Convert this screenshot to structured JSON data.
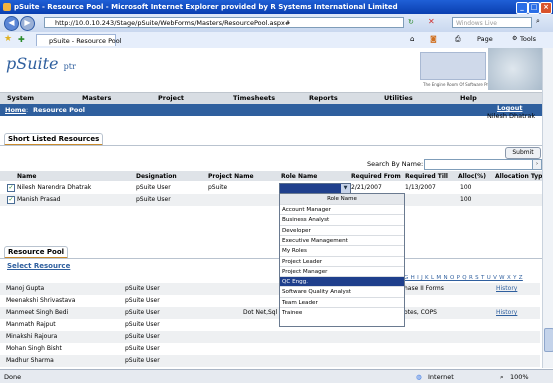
{
  "window": {
    "title": "pSuite - Resource Pool - Microsoft Internet Explorer provided by R Systems International Limited"
  },
  "address": {
    "url": "http://10.0.10.243/Stage/pSuite/WebForms/Masters/ResourcePool.aspx#",
    "search_placeholder": "Windows Live"
  },
  "tabbar": {
    "tab_label": "pSuite - Resource Pool",
    "page_label": "Page",
    "tools_label": "Tools"
  },
  "header": {
    "logo": "pSuite",
    "logo_suffix": "ptr",
    "rs_caption": "The Engine Room Of Software Products"
  },
  "menu": [
    "System",
    "Masters",
    "Project",
    "Timesheets",
    "Reports",
    "Utilities",
    "Help"
  ],
  "breadcrumb": {
    "home": "Home",
    "sep": " : ",
    "current": "Resource Pool",
    "logout": "Logout",
    "user": "Nilesh Dhatrak"
  },
  "shortlisted": {
    "title": "Short Listed Resources",
    "submit": "Submit",
    "search_label": "Search By Name:",
    "columns": [
      "Name",
      "Designation",
      "Project Name",
      "Role Name",
      "Required From",
      "Required Till",
      "Alloc(%)",
      "Allocation Type"
    ],
    "rows": [
      {
        "name": "Nilesh Narendra Dhatrak",
        "designation": "pSuite User",
        "project": "pSuite",
        "from": "2/21/2007",
        "till": "1/13/2007",
        "alloc": "100"
      },
      {
        "name": "Manish Prasad",
        "designation": "pSuite User",
        "project": "",
        "from": "",
        "till": "",
        "alloc": "100"
      }
    ]
  },
  "role_dropdown": {
    "header": "Role Name",
    "options": [
      "Account Manager",
      "Business Analyst",
      "Developer",
      "Executive Management",
      "My Roles",
      "Project Leader",
      "Project Manager",
      "QC Engg.",
      "Software Quality Analyst",
      "Team Leader",
      "Trainee"
    ],
    "selected": "QC Engg."
  },
  "pool": {
    "title": "Resource Pool",
    "select_link": "Select Resource",
    "alphabet": "G H I J K L M N O P Q R S T U V W X Y Z",
    "rows": [
      {
        "name": "Manoj Gupta",
        "designation": "pSuite User",
        "skills": "",
        "extra": "hase II Forms",
        "history": "History"
      },
      {
        "name": "Meenakshi Shrivastava",
        "designation": "pSuite User",
        "skills": "",
        "extra": "",
        "history": ""
      },
      {
        "name": "Manmeet Singh Bedi",
        "designation": "pSuite User",
        "skills": "Dot Net,Sql",
        "extra": "otes, COPS",
        "history": "History"
      },
      {
        "name": "Manmath Rajput",
        "designation": "pSuite User",
        "skills": "",
        "extra": "",
        "history": ""
      },
      {
        "name": "Minakshi Rajoura",
        "designation": "pSuite User",
        "skills": "",
        "extra": "",
        "history": ""
      },
      {
        "name": "Mohan Singh Bisht",
        "designation": "pSuite User",
        "skills": "",
        "extra": "",
        "history": ""
      },
      {
        "name": "Madhur Sharma",
        "designation": "pSuite User",
        "skills": "",
        "extra": "",
        "history": ""
      }
    ]
  },
  "status": {
    "left": "Done",
    "zone": "Internet",
    "zoom": "100%"
  }
}
